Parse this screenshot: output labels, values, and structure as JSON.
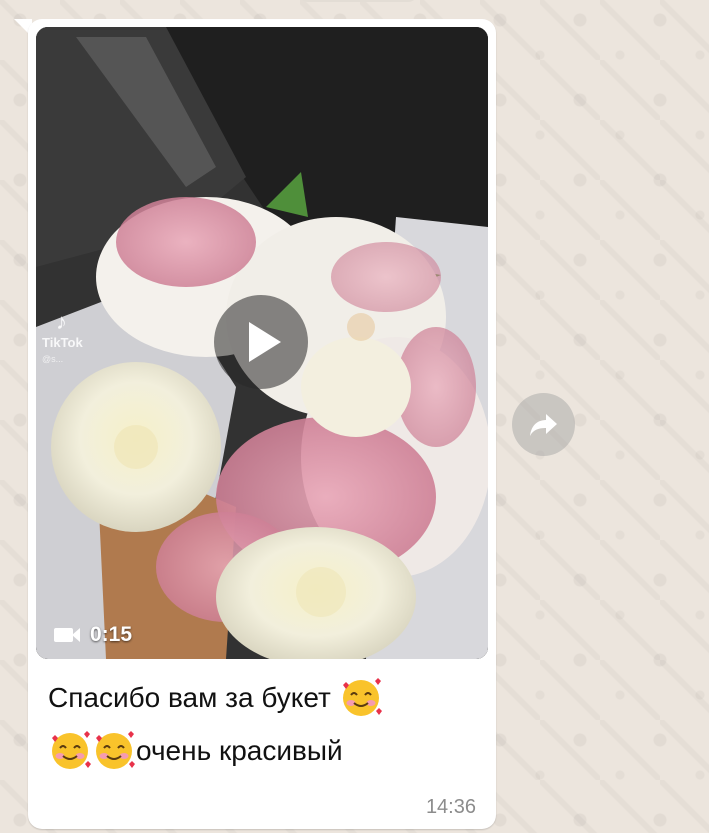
{
  "message": {
    "video": {
      "duration": "0:15",
      "watermark_app": "TikTok",
      "watermark_user": "@s..."
    },
    "caption_line1": "Спасибо вам за букет",
    "caption_line2": "очень красивый",
    "time": "14:36"
  },
  "colors": {
    "chat_bg": "#ece5dd",
    "bubble_bg": "#ffffff",
    "timestamp": "#8c8c8c"
  },
  "icons": {
    "play": "play-icon",
    "camera": "video-camera-icon",
    "forward": "forward-arrow-icon",
    "emoji": "smiling-face-with-hearts"
  }
}
